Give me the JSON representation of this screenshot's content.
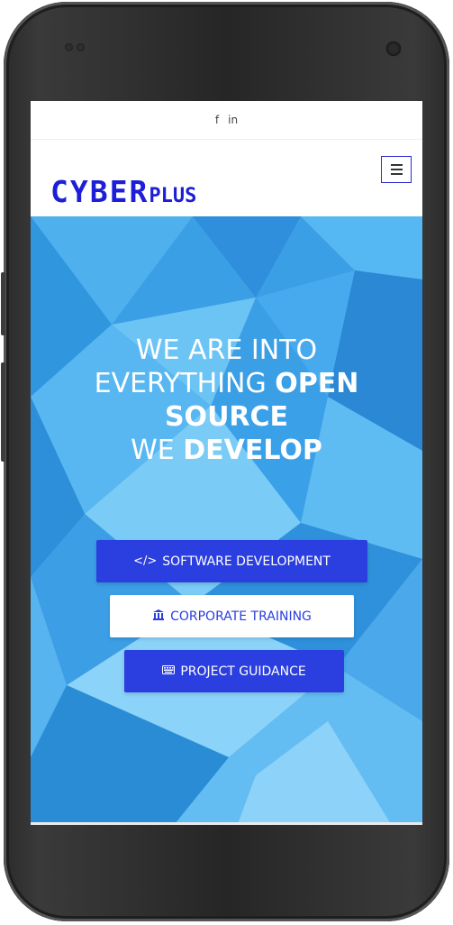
{
  "topbar": {
    "facebook_label": "f",
    "linkedin_label": "in"
  },
  "header": {
    "logo_main": "CYBER",
    "logo_suffix": "PLUS",
    "menu_icon": "hamburger-menu-icon"
  },
  "hero": {
    "line1": "WE ARE INTO",
    "line2_normal": "EVERYTHING ",
    "line2_bold": "OPEN",
    "line3_bold": "SOURCE",
    "line4_normal": "WE ",
    "line4_bold": "DEVELOP"
  },
  "buttons": {
    "software_icon": "</>",
    "software_label": "SOFTWARE DEVELOPMENT",
    "training_icon": "institution-icon",
    "training_label": "CORPORATE TRAINING",
    "guidance_icon": "keyboard-icon",
    "guidance_label": "PROJECT GUIDANCE"
  },
  "colors": {
    "brand_blue": "#1d1fd8",
    "button_blue": "#2b3ee0",
    "hero_blue": "#3a9fe6"
  }
}
